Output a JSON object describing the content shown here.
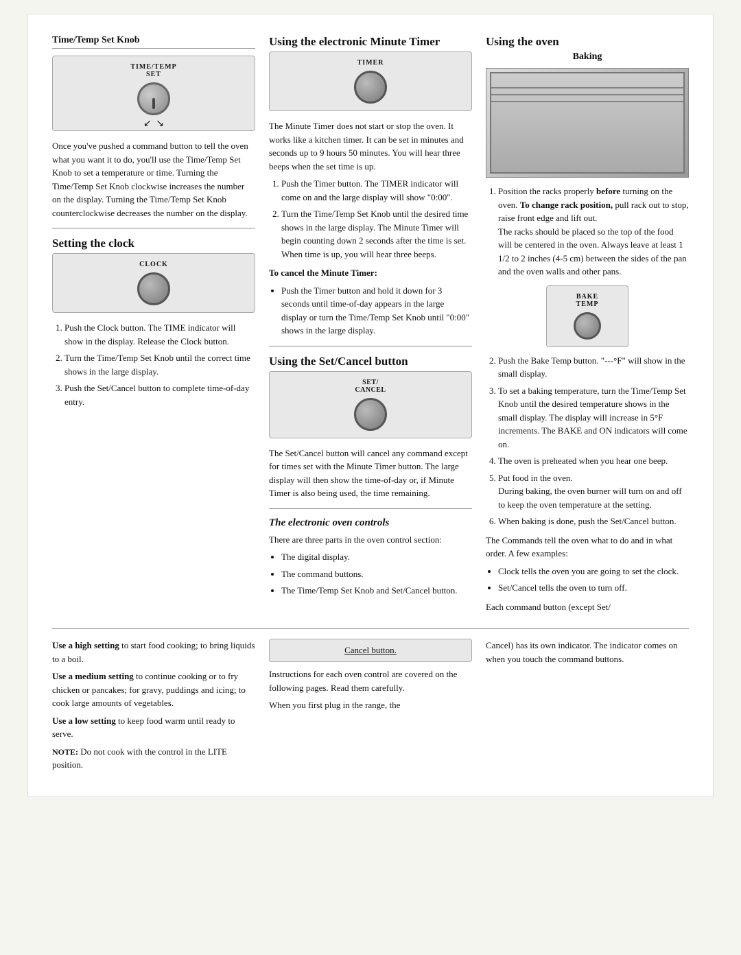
{
  "col1": {
    "section1_title": "Time/Temp Set Knob",
    "knob1_label": "TIME/TEMP\nSET",
    "section1_body": "Once you've pushed a command button to tell the oven what you want it to do, you'll use the Time/Temp Set Knob to set a temperature or time. Turning the Time/Temp Set Knob clockwise increases the number on the display. Turning the Time/Temp Set Knob counterclockwise decreases the number on the display.",
    "section2_title": "Setting the clock",
    "clock_label": "CLOCK",
    "clock_steps": [
      "Push the Clock button. The TIME indicator will show in the display. Release the Clock button.",
      "Turn the Time/Temp Set Knob until the correct time shows in the large display.",
      "Push the Set/Cancel button to complete time-of-day entry."
    ],
    "bottom_use_high_bold": "Use a high setting",
    "bottom_use_high_text": " to start food cooking; to bring liquids to a boil.",
    "bottom_use_medium_bold": "Use a medium setting",
    "bottom_use_medium_text": " to continue cooking or to fry chicken or pancakes; for gravy, puddings and icing; to cook large amounts of vegetables.",
    "bottom_use_low_bold": "Use a low setting",
    "bottom_use_low_text": " to keep food warm until ready to serve.",
    "note_label": "NOTE:",
    "note_text": " Do not cook with the control in the LITE position."
  },
  "col2": {
    "section1_title": "Using the electronic Minute Timer",
    "timer_label": "TIMER",
    "section1_body": "The Minute Timer does not start or stop the oven. It works like a kitchen timer. It can be set in minutes and seconds up to 9 hours 50 minutes. You will hear three beeps when the set time is up.",
    "timer_steps": [
      "Push the Timer button. The TIMER indicator will come on and the large display will show \"0:00\".",
      "Turn the Time/Temp Set Knob until the desired time shows in the large display. The Minute Timer will begin counting down 2 seconds after the time is set.\nWhen time is up, you will hear three beeps."
    ],
    "cancel_title": "To cancel the Minute Timer:",
    "cancel_bullets": [
      "Push the Timer button and hold it down for 3 seconds until time-of-day appears in the large display or turn the Time/Temp Set Knob until \"0:00\" shows in the large display."
    ],
    "section2_title": "Using the Set/Cancel button",
    "set_cancel_label": "SET/\nCANCEL",
    "set_cancel_body": "The Set/Cancel button will cancel any command except for times set with the Minute Timer button. The large display will then show the time-of-day or, if Minute Timer is also being used, the time remaining.",
    "bottom_controls_title": "The electronic oven controls",
    "bottom_controls_body": "There are three parts in the oven control section:",
    "bottom_controls_bullets": [
      "The digital display.",
      "The command buttons.",
      "The Time/Temp Set Knob and Set/Cancel button."
    ],
    "cancel_btn_label": "Cancel button.",
    "cancel_btn_body": "Instructions for each oven control are covered on the following pages. Read them carefully.",
    "cancel_btn_body2": "When you first plug in the range, the"
  },
  "col3": {
    "section1_title": "Using the oven",
    "section1_subtitle": "Baking",
    "bake_label": "BAKE\nTEMP",
    "baking_steps": [
      "Position the racks properly before turning on the oven. To change rack position, pull rack out to stop, raise front edge and lift out.\nThe racks should be placed so the top of the food will be centered in the oven. Always leave at least 1 1/2 to 2 inches (4-5 cm) between the sides of the pan and the oven walls and other pans.",
      "Push the Bake Temp button. \"---°F\" will show in the small display.",
      "To set a baking temperature, turn the Time/Temp Set Knob until the desired temperature shows in the small display. The display will increase in 5°F increments. The BAKE and ON indicators will come on.",
      "The oven is preheated when you hear one beep.",
      "Put food in the oven.\nDuring baking, the oven burner will turn on and off to keep the oven temperature at the setting.",
      "When baking is done, push the Set/Cancel button."
    ],
    "step1_bold_before": "before",
    "step1_bold_change": "To change rack position,",
    "controls_text": "The Commands tell the oven what to do and in what order. A few examples:",
    "examples": [
      "Clock tells the oven you are going to set the clock.",
      "Set/Cancel tells the oven to turn off."
    ],
    "bottom_cancel_body": "Cancel) has its own indicator. The indicator comes on when you touch the command buttons.",
    "bottom_each_command": "Each command button (except Set/"
  }
}
